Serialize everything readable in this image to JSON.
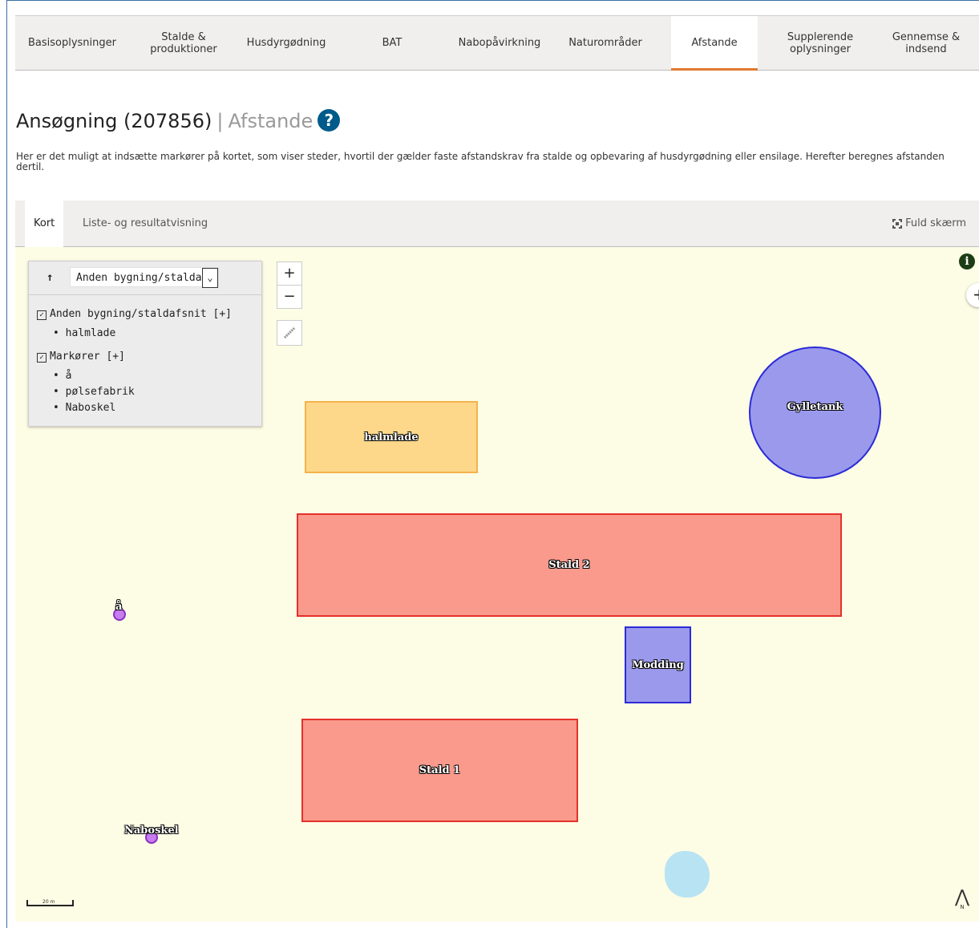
{
  "tabs": [
    {
      "label": "Basisoplysninger"
    },
    {
      "label": "Stalde &\nproduktioner"
    },
    {
      "label": "Husdyrgødning"
    },
    {
      "label": "BAT"
    },
    {
      "label": "Nabopåvirkning"
    },
    {
      "label": "Naturområder"
    },
    {
      "label": "Afstande",
      "active": true
    },
    {
      "label": "Supplerende\noplysninger"
    },
    {
      "label": "Gennemse &\nindsend"
    }
  ],
  "page": {
    "title": "Ansøgning (207856)",
    "separator": "|",
    "subtitle": "Afstande",
    "help_glyph": "?",
    "description": "Her er det muligt at indsætte markører på kortet, som viser steder, hvortil der gælder faste afstandskrav fra stalde og opbevaring af husdyrgødning eller ensilage. Herefter beregnes afstanden dertil."
  },
  "view_tabs": {
    "map": "Kort",
    "list": "Liste- og resultatvisning",
    "fullscreen": "Fuld skærm"
  },
  "layer_panel": {
    "up_arrow": "🠕",
    "select_value": "Anden bygning/staldaf",
    "groups": [
      {
        "label": "Anden bygning/staldafsnit",
        "expand": "[+]",
        "checked": true,
        "items": [
          "halmlade"
        ]
      },
      {
        "label": "Markører",
        "expand": "[+]",
        "checked": true,
        "items": [
          "å",
          "pølsefabrik",
          "Naboskel"
        ]
      }
    ]
  },
  "map_controls": {
    "zoom_in": "+",
    "zoom_out": "−",
    "info_glyph": "i",
    "plus_right": "+",
    "scale_label": "20 m",
    "north_label": "N"
  },
  "map_features": {
    "buildings": [
      {
        "label": "halmlade",
        "fill": "#fdd88a",
        "stroke": "#f4b24a"
      },
      {
        "label": "Stald 2",
        "fill": "#f99a8c",
        "stroke": "#e5312b"
      },
      {
        "label": "Modding",
        "fill": "#9b99ec",
        "stroke": "#2b2bd6"
      },
      {
        "label": "Stald 1",
        "fill": "#f99a8c",
        "stroke": "#e5312b"
      },
      {
        "label": "Gylletank",
        "fill": "#9b99ec",
        "stroke": "#2b2bd6"
      }
    ],
    "markers": [
      {
        "label": "å"
      },
      {
        "label": "Naboskel"
      }
    ],
    "background": "#fdfce5",
    "accent": "#e07a2f"
  }
}
